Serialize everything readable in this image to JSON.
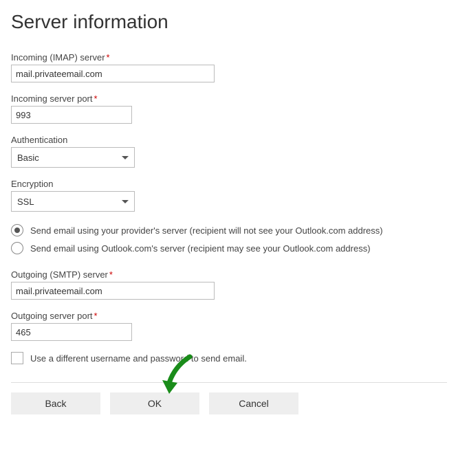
{
  "title": "Server information",
  "incoming_server": {
    "label": "Incoming (IMAP) server",
    "required": true,
    "value": "mail.privateemail.com"
  },
  "incoming_port": {
    "label": "Incoming server port",
    "required": true,
    "value": "993"
  },
  "authentication": {
    "label": "Authentication",
    "value": "Basic"
  },
  "encryption": {
    "label": "Encryption",
    "value": "SSL"
  },
  "send_via": {
    "option_provider": "Send email using your provider's server (recipient will not see your Outlook.com address)",
    "option_outlook": "Send email using Outlook.com's server (recipient may see your Outlook.com address)",
    "selected": "provider"
  },
  "outgoing_server": {
    "label": "Outgoing (SMTP) server",
    "required": true,
    "value": "mail.privateemail.com"
  },
  "outgoing_port": {
    "label": "Outgoing server port",
    "required": true,
    "value": "465"
  },
  "diff_credentials": {
    "label": "Use a different username and password to send email.",
    "checked": false
  },
  "buttons": {
    "back": "Back",
    "ok": "OK",
    "cancel": "Cancel"
  },
  "required_marker": "*"
}
